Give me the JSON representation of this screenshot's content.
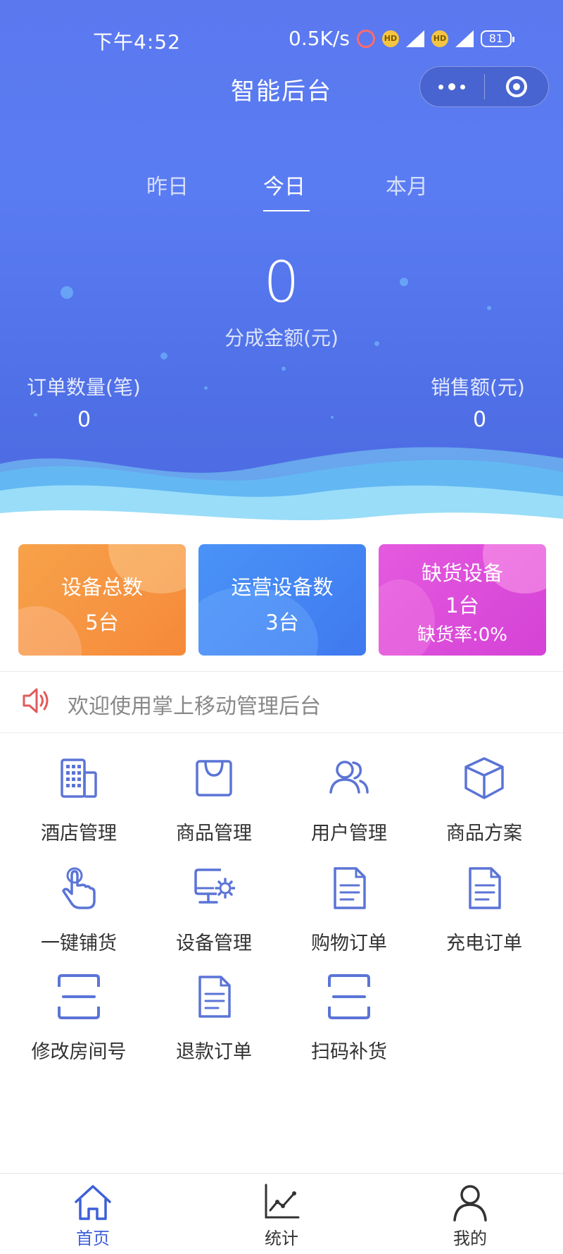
{
  "status_bar": {
    "time": "下午4:52",
    "speed": "0.5K/s",
    "hd1": "HD",
    "net1": "4G",
    "hd2": "HD",
    "net2": "5G",
    "battery": "81"
  },
  "nav": {
    "title": "智能后台"
  },
  "period_tabs": {
    "yesterday": "昨日",
    "today": "今日",
    "month": "本月",
    "selected": "今日"
  },
  "summary": {
    "amount": "0",
    "amount_label": "分成金额(元)",
    "orders_label": "订单数量(笔)",
    "orders_value": "0",
    "sales_label": "销售额(元)",
    "sales_value": "0"
  },
  "cards": {
    "total": {
      "title": "设备总数",
      "value": "5台"
    },
    "operating": {
      "title": "运营设备数",
      "value": "3台"
    },
    "shortage": {
      "title": "缺货设备",
      "value": "1台",
      "rate": "缺货率:0%"
    }
  },
  "notice": {
    "text": "欢迎使用掌上移动管理后台"
  },
  "menu": {
    "hotel": "酒店管理",
    "goods": "商品管理",
    "users": "用户管理",
    "goods_plan": "商品方案",
    "restock_one_key": "一键铺货",
    "devices": "设备管理",
    "shopping_orders": "购物订单",
    "charging_orders": "充电订单",
    "room_no": "修改房间号",
    "refund_orders": "退款订单",
    "scan_restock": "扫码补货"
  },
  "tabbar": {
    "home": "首页",
    "stats": "统计",
    "mine": "我的",
    "active": "首页"
  },
  "colors": {
    "primary": "#5a7cf2",
    "icon": "#5b74d6",
    "card_orange": "#f5893a",
    "card_blue": "#3f79ef",
    "card_magenta": "#d542d6",
    "notice_red": "#e05a5a",
    "tab_active": "#3d5fd8"
  }
}
